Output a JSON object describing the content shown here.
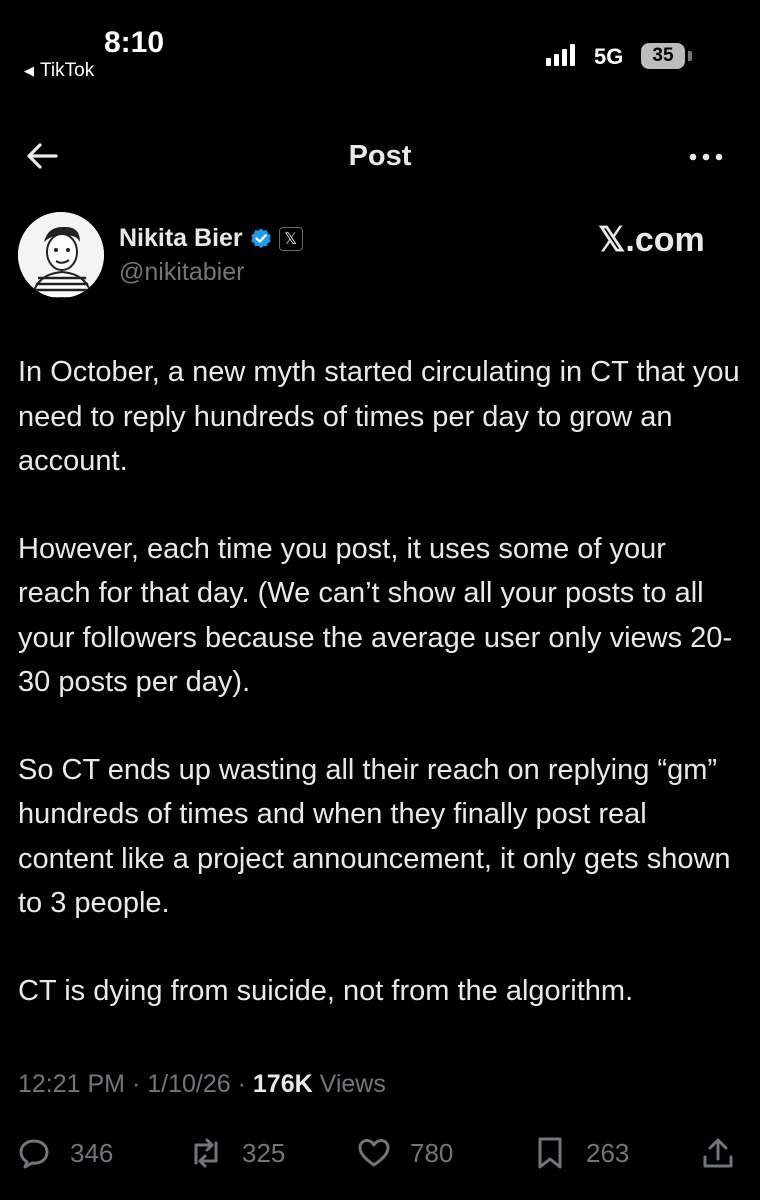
{
  "status_bar": {
    "time": "8:10",
    "back_app": "TikTok",
    "network": "5G",
    "battery": "35"
  },
  "header": {
    "title": "Post"
  },
  "author": {
    "name": "Nikita Bier",
    "handle": "@nikitabier",
    "badge_text": "𝕏",
    "watermark": "𝕏.com"
  },
  "post": {
    "paragraphs": [
      "In October, a new myth started circulating in CT that you need to reply hundreds of times per day to grow an account.",
      "However, each time you post, it uses some of your reach for that day. (We can’t show all your posts to all your followers because the average user only views 20-30 posts per day).",
      "So CT ends up wasting all their reach on replying “gm” hundreds of times and when they finally post real content like a project announcement, it only gets shown to 3 people.",
      "CT is dying from suicide, not from the algorithm."
    ],
    "time": "12:21 PM",
    "date": "1/10/26",
    "views_count": "176K",
    "views_label": "Views",
    "separator": "·"
  },
  "actions": {
    "replies": "346",
    "reposts": "325",
    "likes": "780",
    "bookmarks": "263"
  },
  "colors": {
    "background": "#000000",
    "text": "#e7e9ea",
    "secondary": "#71767b",
    "verified": "#1d9bf0"
  }
}
